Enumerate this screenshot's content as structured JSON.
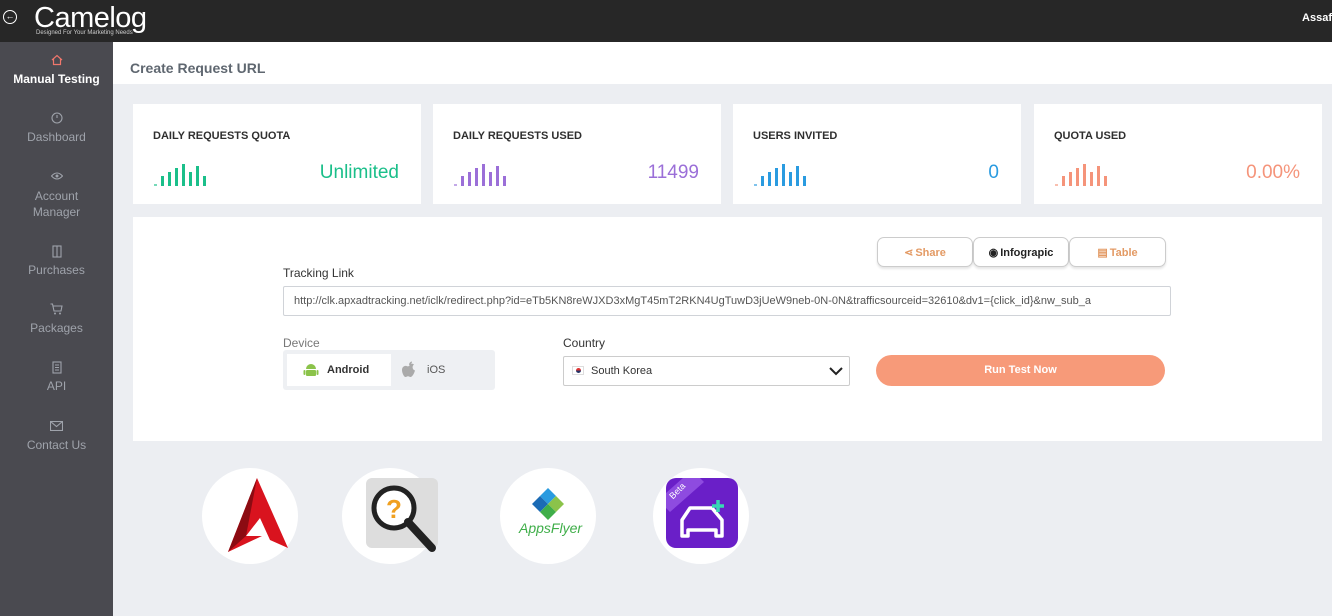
{
  "header": {
    "logo_text": "Camelog",
    "logo_tagline": "Designed For Your Marketing Needs",
    "user_name": "Assaf"
  },
  "sidebar": {
    "items": [
      {
        "label": "Manual Testing",
        "icon": "home-icon",
        "active": true
      },
      {
        "label": "Dashboard",
        "icon": "gauge-icon",
        "active": false
      },
      {
        "label": "Account Manager",
        "icon": "eye-icon",
        "active": false
      },
      {
        "label": "Purchases",
        "icon": "columns-icon",
        "active": false
      },
      {
        "label": "Packages",
        "icon": "cart-icon",
        "active": false
      },
      {
        "label": "API",
        "icon": "document-icon",
        "active": false
      },
      {
        "label": "Contact Us",
        "icon": "mail-icon",
        "active": false
      }
    ]
  },
  "page": {
    "title": "Create Request URL"
  },
  "stats": [
    {
      "label": "DAILY REQUESTS QUOTA",
      "value": "Unlimited",
      "color": "#1bbf8a"
    },
    {
      "label": "DAILY REQUESTS USED",
      "value": "11499",
      "color": "#9b6fd8"
    },
    {
      "label": "USERS INVITED",
      "value": "0",
      "color": "#2a9be0"
    },
    {
      "label": "QUOTA USED",
      "value": "0.00%",
      "color": "#f5947a"
    }
  ],
  "tabs": [
    {
      "label": "Share",
      "icon": "share-icon",
      "active": false
    },
    {
      "label": "Infograpic",
      "icon": "globe-icon",
      "active": true
    },
    {
      "label": "Table",
      "icon": "table-icon",
      "active": false
    }
  ],
  "form": {
    "tracking_label": "Tracking Link",
    "tracking_value": "http://clk.apxadtracking.net/iclk/redirect.php?id=eTb5KN8reWJXD3xMgT45mT2RKN4UgTuwD3jUeW9neb-0N-0N&trafficsourceid=32610&dv1={click_id}&nw_sub_a",
    "device_label": "Device",
    "device_options": [
      {
        "label": "Android",
        "icon": "android-icon",
        "selected": true
      },
      {
        "label": "iOS",
        "icon": "apple-icon",
        "selected": false
      }
    ],
    "country_label": "Country",
    "country_value": "South Korea",
    "country_flag": "south-korea-flag-icon",
    "run_button": "Run Test Now"
  },
  "partners": [
    {
      "name": "adjust-logo"
    },
    {
      "name": "magnifier-logo"
    },
    {
      "name": "appsflyer-logo",
      "text": "AppsFlyer"
    },
    {
      "name": "beta-car-logo",
      "badge": "Beta"
    }
  ]
}
